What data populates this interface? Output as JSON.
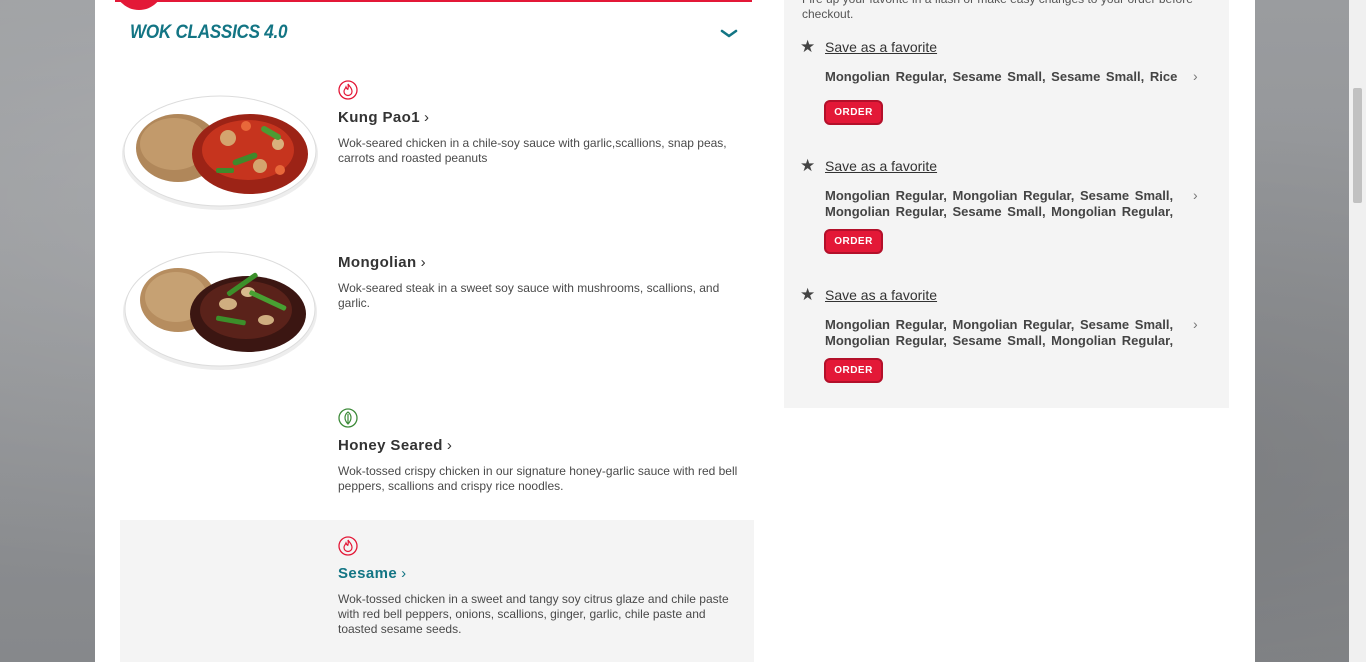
{
  "section": {
    "title": "WOK CLASSICS 4.0",
    "chevron_icon": "chevron-down-icon"
  },
  "menu_items": [
    {
      "name": "Kung Pao1",
      "description": "Wok-seared chicken in a chile-soy sauce with garlic,scallions, snap peas, carrots and roasted peanuts",
      "diet_icon": "spicy-flame-icon"
    },
    {
      "name": "Mongolian",
      "description": "Wok-seared steak in a sweet soy sauce with mushrooms, scallions, and garlic."
    },
    {
      "name": "Honey Seared",
      "description": "Wok-tossed crispy chicken in our signature honey-garlic sauce with red bell peppers, scallions and crispy rice noodles.",
      "diet_icon": "leaf-icon"
    },
    {
      "name": "Sesame",
      "description": "Wok-tossed chicken in a sweet and tangy soy citrus glaze and chile paste with red bell peppers, onions, scallions, ginger, garlic, chile paste and toasted sesame seeds.",
      "diet_icon": "spicy-flame-icon"
    }
  ],
  "favorites_panel": {
    "intro": "Fire up your favorite in a flash or make easy changes to your order before checkout.",
    "favorites": [
      {
        "save_label": "Save as a favorite",
        "items": "Mongolian Regular, Sesame Small, Sesame Small, Rice",
        "order_label": "ORDER"
      },
      {
        "save_label": "Save as a favorite",
        "items": "Mongolian Regular, Mongolian Regular, Sesame Small, Mongolian Regular, Sesame Small, Mongolian Regular,",
        "order_label": "ORDER"
      },
      {
        "save_label": "Save as a favorite",
        "items": "Mongolian Regular, Mongolian Regular, Sesame Small, Mongolian Regular, Sesame Small, Mongolian Regular,",
        "order_label": "ORDER"
      }
    ]
  },
  "colors": {
    "brand_red": "#e31837",
    "teal": "#137584",
    "panel_bg": "#f4f4f4"
  }
}
